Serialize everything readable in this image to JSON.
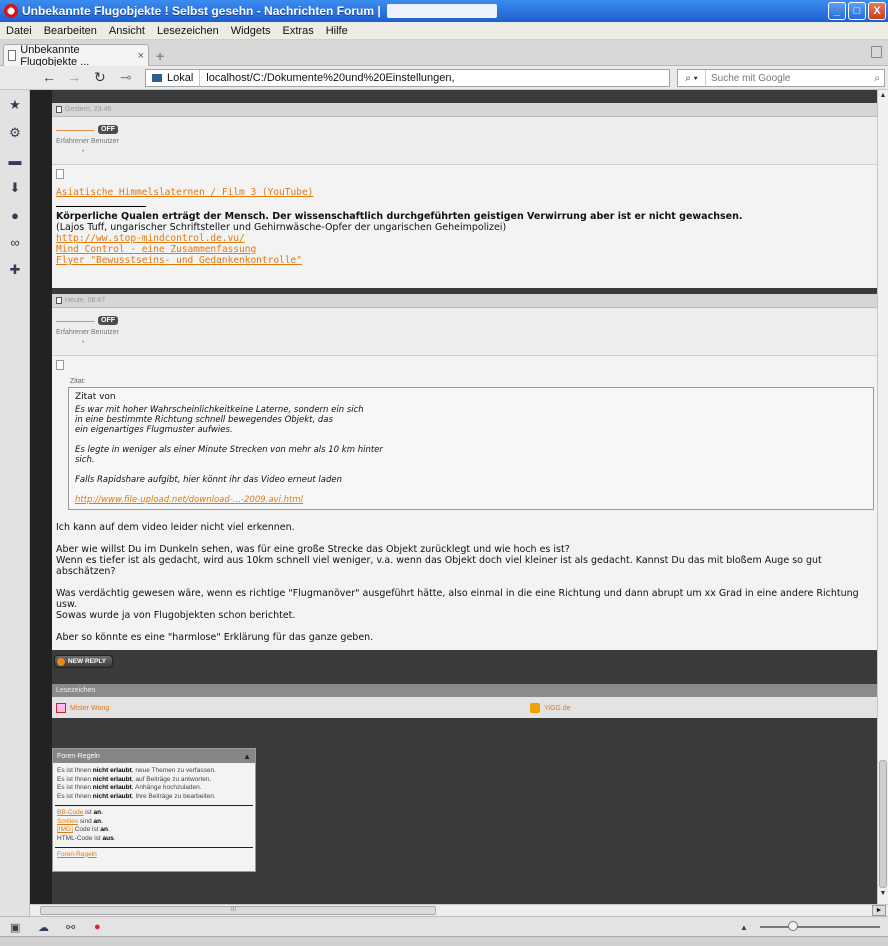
{
  "window": {
    "title": "Unbekannte Flugobjekte ! Selbst gesehn - Nachrichten Forum |",
    "buttons": {
      "minimize": "_",
      "maximize": "□",
      "close": "X"
    }
  },
  "menu": [
    "Datei",
    "Bearbeiten",
    "Ansicht",
    "Lesezeichen",
    "Widgets",
    "Extras",
    "Hilfe"
  ],
  "tab": {
    "label": "Unbekannte Flugobjekte ...",
    "close": "×",
    "new": "+"
  },
  "nav": {
    "back": "←",
    "forward": "→",
    "reload": "↻",
    "key": "⊸",
    "site_label": "Lokal",
    "url": "localhost/C:/Dokumente%20und%20Einstellungen,",
    "search_placeholder": "Suche mit Google",
    "search_engine": "⌕ ▾",
    "search_go": "⌕"
  },
  "panel_icons": [
    "star-icon",
    "gear-icon",
    "note-icon",
    "download-icon",
    "clock-icon",
    "link-icon",
    "plus-icon"
  ],
  "panel_glyphs": [
    "★",
    "⚙",
    "▬",
    "⬇",
    "●",
    "∞",
    "✚"
  ],
  "post1": {
    "head": "Gestern, 23:46",
    "badge": "OFF",
    "rank": "Erfahrener Benutzer",
    "dot": "•",
    "link_video": "Asiatische Himmelslaternen / Film 3 (YouTube)",
    "bold_line": "Körperliche Qualen erträgt der Mensch. Der wissenschaftlich durchgeführten geistigen Verwirrung aber ist er nicht gewachsen.",
    "attribution": "(Lajos Tuff, ungarischer Schriftsteller und Gehirnwäsche-Opfer der ungarischen Geheimpolizei)",
    "links": [
      "http://ww.stop-mindcontrol.de.vu/",
      "Mind Control - eine Zusammenfassung",
      "Flyer \"Bewusstseins- und Gedankenkontrolle\""
    ]
  },
  "post2": {
    "head": "Heute, 06:47",
    "badge": "OFF",
    "rank": "Erfahrener Benutzer",
    "dot": "•",
    "quote_label": "Zitat:",
    "quote_from": "Zitat von",
    "quote_lines": [
      "Es war mit hoher Wahrscheinlichkeitkeine Laterne, sondern ein sich",
      "in eine bestimmte Richtung schnell bewegendes Objekt, das",
      "ein eigenartiges Flugmuster aufwies.",
      "",
      "Es legte in weniger als einer Minute Strecken von mehr als 10 km hinter",
      "sich.",
      "",
      "Falls Rapidshare aufgibt, hier könnt ihr das Video erneut laden",
      ""
    ],
    "quote_link": "http://www.file-upload.net/download-...-2009.avi.html",
    "body": [
      "Ich kann auf dem video leider nicht viel erkennen.",
      "",
      "Aber wie willst Du im Dunkeln sehen, was für eine große Strecke das Objekt zurücklegt und wie hoch es ist?",
      "Wenn es tiefer ist als gedacht, wird aus 10km schnell viel weniger, v.a. wenn das Objekt doch viel kleiner ist als gedacht. Kannst Du das mit bloßem Auge so gut abschätzen?",
      "",
      "Was verdächtig gewesen wäre, wenn es richtige \"Flugmanöver\" ausgeführt hätte, also einmal in die eine Richtung und dann abrupt um xx Grad in eine andere Richtung usw.",
      "Sowas wurde ja von Flugobjekten schon berichtet.",
      "",
      "Aber so könnte es eine \"harmlose\" Erklärung für das ganze geben."
    ]
  },
  "new_reply": "NEW REPLY",
  "bookmarks": {
    "header": "Lesezeichen",
    "items": [
      "Mister Wong",
      "YiGG.de"
    ]
  },
  "rules": {
    "header": "Foren-Regeln",
    "chevron": "▲",
    "lines": [
      {
        "pre": "Es ist Ihnen ",
        "b": "nicht erlaubt",
        "post": ", neue Themen zu verfassen."
      },
      {
        "pre": "Es ist Ihnen ",
        "b": "nicht erlaubt",
        "post": ", auf Beiträge zu antworten."
      },
      {
        "pre": "Es ist Ihnen ",
        "b": "nicht erlaubt",
        "post": ", Anhänge hochzuladen."
      },
      {
        "pre": "Es ist Ihnen ",
        "b": "nicht erlaubt",
        "post": ", Ihre Beiträge zu bearbeiten."
      }
    ],
    "codes": [
      {
        "link": "BB-Code",
        "mid": " ist ",
        "b": "an",
        "end": "."
      },
      {
        "link": "Smilies",
        "mid": " sind ",
        "b": "an",
        "end": "."
      },
      {
        "link": "[IMG]",
        "mid": " Code ist ",
        "b": "an",
        "end": "."
      },
      {
        "link": "",
        "mid": "HTML-Code ist ",
        "b": "aus",
        "end": "."
      }
    ],
    "footer_link": "Foren-Regeln"
  },
  "scroll": {
    "up": "▲",
    "down": "▼",
    "right": "►",
    "grip": "III"
  },
  "status_icons": [
    "panel-toggle-icon",
    "cloud-icon",
    "share-icon",
    "unite-icon"
  ],
  "status_glyphs": [
    "▣",
    "☁",
    "⚯",
    "●"
  ],
  "zoom": {
    "arrow": "▲",
    "level": 0.25
  }
}
